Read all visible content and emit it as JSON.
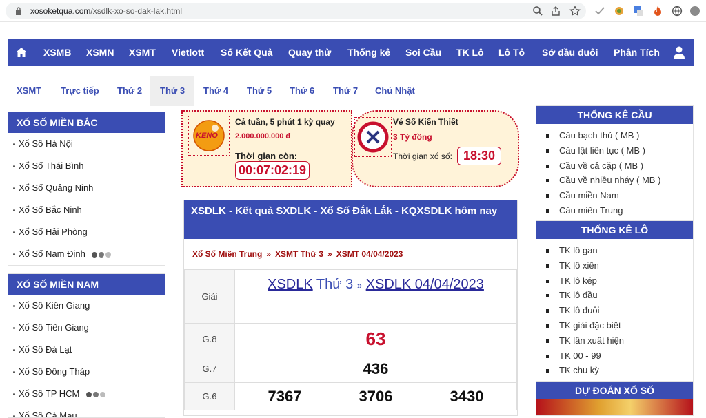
{
  "browser": {
    "url_host": "xosoketqua.com",
    "url_path": "/xsdlk-xo-so-dak-lak.html"
  },
  "main_nav": {
    "items": [
      "XSMB",
      "XSMN",
      "XSMT",
      "Vietlott",
      "Sổ Kết Quả",
      "Quay thử",
      "Thống kê",
      "Soi Cầu",
      "TK Lô",
      "Lô Tô",
      "Sớ đầu đuôi",
      "Phân Tích"
    ]
  },
  "sub_nav": {
    "items": [
      "XSMT",
      "Trực tiếp",
      "Thứ 2",
      "Thứ 3",
      "Thứ 4",
      "Thứ 5",
      "Thứ 6",
      "Thứ 7",
      "Chủ Nhật"
    ],
    "active": "Thứ 3"
  },
  "left_sidebar": {
    "north": {
      "title": "XỔ SỐ MIỀN BẮC",
      "items": [
        "Xổ Số Hà Nội",
        "Xổ Số Thái Bình",
        "Xổ Số Quảng Ninh",
        "Xổ Số Bắc Ninh",
        "Xổ Số Hải Phòng",
        "Xổ Số Nam Định"
      ]
    },
    "south": {
      "title": "XỔ SỐ MIỀN NAM",
      "items": [
        "Xổ Số Kiên Giang",
        "Xổ Số Tiền Giang",
        "Xổ Số Đà Lạt",
        "Xổ Số Đồng Tháp",
        "Xổ Số TP HCM",
        "Xổ Số Cà Mau"
      ]
    }
  },
  "promo_keno": {
    "logo_text": "KENO",
    "line1": "Cả tuần, 5 phút 1 kỳ quay",
    "prize": "2.000.000.000 đ",
    "countdown_label": "Thời gian còn:",
    "countdown": "00:07:02:19"
  },
  "promo_kienthiet": {
    "title": "Vé Số Kiến Thiết",
    "prize": "3 Tỷ đồng",
    "time_label": "Thời gian xổ số:",
    "time": "18:30"
  },
  "result": {
    "title": "XSDLK - Kết quả SXDLK - Xổ Số Đắk Lắk - KQXSDLK hôm nay",
    "breadcrumb": [
      "Xổ Số Miền Trung",
      "XSMT Thứ 3",
      "XSMT 04/04/2023"
    ],
    "breadcrumb_sep": "»",
    "header_label": "Giải",
    "header_link1": "XSDLK",
    "header_day": "Thứ 3",
    "header_sep": "»",
    "header_link2": "XSDLK 04/04/2023",
    "rows": [
      {
        "label": "G.8",
        "values": [
          "63"
        ]
      },
      {
        "label": "G.7",
        "values": [
          "436"
        ]
      },
      {
        "label": "G.6",
        "values": [
          "7367",
          "3706",
          "3430"
        ]
      }
    ]
  },
  "right_sidebar": {
    "cau": {
      "title": "THỐNG KÊ CẦU",
      "items": [
        "Cầu bạch thủ ( MB )",
        "Cầu lật liên tục ( MB )",
        "Cầu về cả cặp ( MB )",
        "Cầu về nhiều nháy ( MB )",
        "Cầu miền Nam",
        "Cầu miền Trung"
      ]
    },
    "lo": {
      "title": "THỐNG KÊ LÔ",
      "items": [
        "TK lô gan",
        "TK lô xiên",
        "TK lô kép",
        "TK lô đầu",
        "TK lô đuôi",
        "TK giải đặc biệt",
        "TK lần xuất hiện",
        "TK 00 - 99",
        "TK chu kỳ"
      ]
    },
    "dudoan": {
      "title": "DỰ ĐOÁN XỔ SỐ"
    }
  },
  "colors": {
    "nav_blue": "#3a4db3",
    "prize_red": "#c8102e",
    "promo_bg": "#fff3d9"
  }
}
